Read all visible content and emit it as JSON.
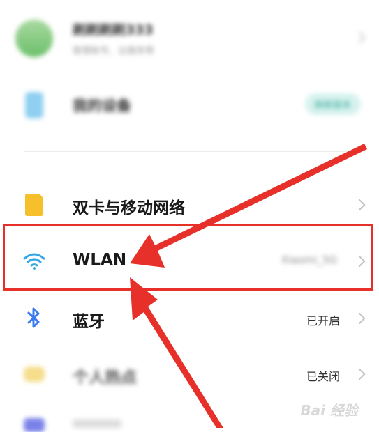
{
  "profile": {
    "name": "刷刷刷刷333",
    "subtitle": "管理账号、云服务等"
  },
  "device": {
    "label": "我的设备",
    "badge": "刷新版本"
  },
  "items": [
    {
      "label": "双卡与移动网络",
      "status": ""
    },
    {
      "label": "WLAN",
      "status": "Xiaomi_5G"
    },
    {
      "label": "蓝牙",
      "status": "已开启"
    },
    {
      "label": "个人热点",
      "status": "已关闭"
    }
  ],
  "watermark": "Bai 经验",
  "colors": {
    "highlight": "#e8302a",
    "wifi": "#35a7e6",
    "bluetooth": "#3b7cf0",
    "sim": "#f5c02c"
  }
}
